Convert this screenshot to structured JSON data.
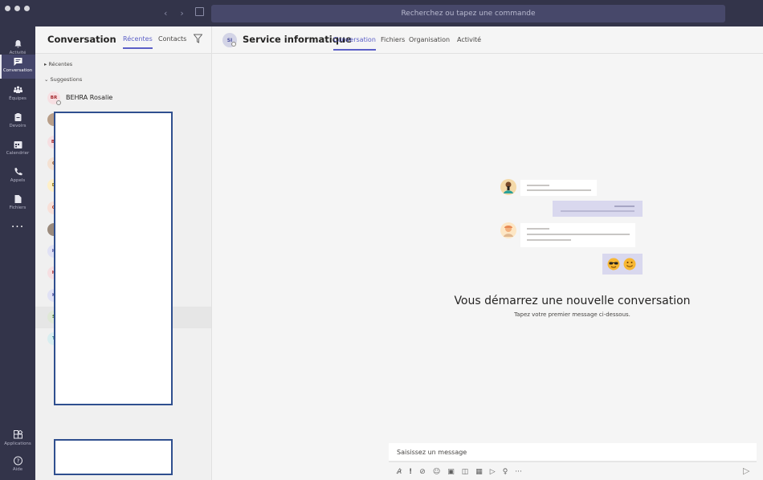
{
  "search": {
    "placeholder": "Recherchez ou tapez une commande"
  },
  "rail": {
    "items": [
      {
        "label": "Activité",
        "icon": "bell-icon"
      },
      {
        "label": "Conversation",
        "icon": "chat-icon",
        "active": true
      },
      {
        "label": "Équipes",
        "icon": "teams-icon"
      },
      {
        "label": "Devoirs",
        "icon": "assignments-icon"
      },
      {
        "label": "Calendrier",
        "icon": "calendar-icon"
      },
      {
        "label": "Appels",
        "icon": "phone-icon"
      },
      {
        "label": "Fichiers",
        "icon": "file-icon"
      }
    ],
    "more": "···",
    "apps_label": "Applications",
    "help_label": "Aide"
  },
  "list": {
    "title": "Conversation",
    "tabs": [
      "Récentes",
      "Contacts"
    ],
    "sections": {
      "recent": "Récentes",
      "suggestions": "Suggestions"
    },
    "contacts": [
      {
        "initials": "BR",
        "name": "BEHRA Rosalie",
        "bg": "#f6dfe2",
        "fg": "#a4262c"
      },
      {
        "initials": "",
        "name": "",
        "bg": "#b89e88",
        "fg": "#5a3d2b"
      },
      {
        "initials": "BI",
        "name": "",
        "bg": "#f6dfe2",
        "fg": "#a4262c"
      },
      {
        "initials": "C",
        "name": "",
        "bg": "#f4e1d2",
        "fg": "#8a4b1a"
      },
      {
        "initials": "D",
        "name": "",
        "bg": "#fff0c7",
        "fg": "#8a6d00"
      },
      {
        "initials": "G",
        "name": "",
        "bg": "#f8e0d8",
        "fg": "#b4381c"
      },
      {
        "initials": "",
        "name": "",
        "bg": "#9a8a7c",
        "fg": "#3e2e22"
      },
      {
        "initials": "H",
        "name": "",
        "bg": "#e0e1f5",
        "fg": "#4b4f9e"
      },
      {
        "initials": "H",
        "name": "",
        "bg": "#f6dfe2",
        "fg": "#a4262c"
      },
      {
        "initials": "K",
        "name": "",
        "bg": "#e0e1f5",
        "fg": "#4b4f9e"
      },
      {
        "initials": "S",
        "name": "",
        "bg": "#dfe8d6",
        "fg": "#3b6b23",
        "selected": true
      },
      {
        "initials": "T",
        "name": "",
        "bg": "#d8eef0",
        "fg": "#1b6b74"
      }
    ]
  },
  "header": {
    "badge": "SI",
    "title": "Service informatique",
    "tabs": [
      "Conversation",
      "Fichiers",
      "Organisation",
      "Activité"
    ]
  },
  "empty_state": {
    "title": "Vous démarrez une nouvelle conversation",
    "subtitle": "Tapez votre premier message ci-dessous."
  },
  "composer": {
    "placeholder": "Saisissez un message"
  },
  "colors": {
    "rail": "#33344a",
    "accent": "#5b5fc7"
  }
}
